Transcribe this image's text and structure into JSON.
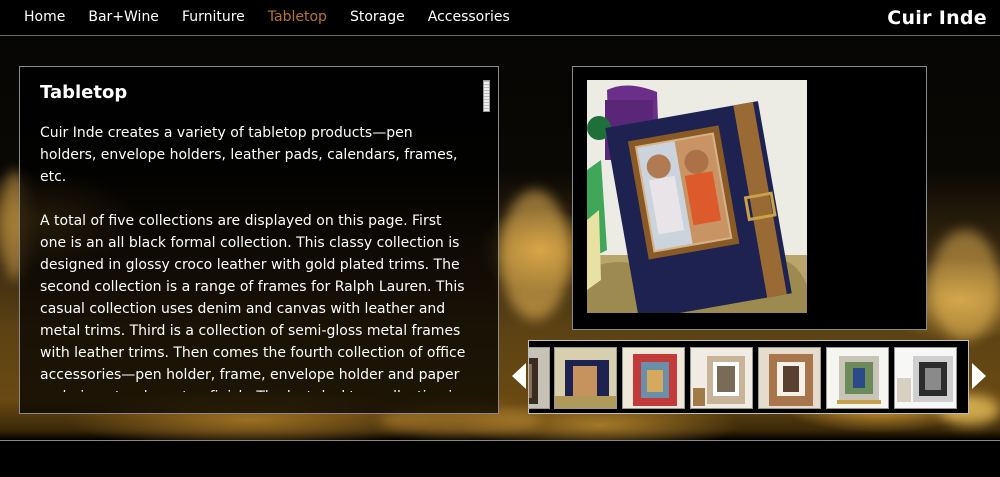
{
  "nav": {
    "items": [
      "Home",
      "Bar+Wine",
      "Furniture",
      "Tabletop",
      "Storage",
      "Accessories"
    ],
    "active": "Tabletop"
  },
  "brand": "Cuir Inde",
  "content": {
    "title": "Tabletop",
    "paragraphs": [
      "Cuir Inde creates a variety of tabletop products—pen holders, envelope holders, leather pads, calendars, frames, etc.",
      "A total of five collections are displayed on this page. First one is an all black formal collection. This classy collection is designed in glossy croco leather with gold plated trims. The second collection is a range of frames for Ralph Lauren. This casual collection uses denim and canvas with leather and metal trims. Third is a collection of semi-gloss metal frames with leather trims. Then comes the fourth collection of office accessories—pen holder, frame, envelope holder and paper pad—in natural veg tan finish. The last desktop collection is a"
    ]
  },
  "featured": {
    "icon": "framed-photo-image"
  },
  "thumbnails": [
    {
      "icon": "frame-thumbnail"
    },
    {
      "icon": "frame-thumbnail"
    },
    {
      "icon": "frame-thumbnail"
    },
    {
      "icon": "frame-thumbnail"
    },
    {
      "icon": "frame-thumbnail"
    },
    {
      "icon": "frame-thumbnail"
    }
  ],
  "colors": {
    "accent": "#b8742e",
    "background": "#000000",
    "text": "#ffffff"
  }
}
